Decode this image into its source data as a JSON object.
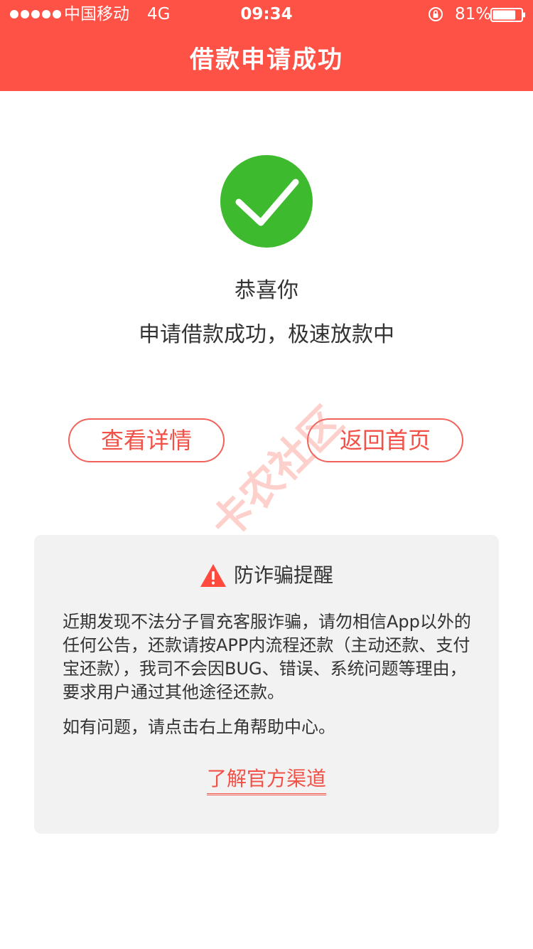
{
  "status_bar": {
    "carrier": "中国移动",
    "network": "4G",
    "time": "09:34",
    "battery_percent": "81%",
    "battery_level": 0.81
  },
  "header": {
    "title": "借款申请成功"
  },
  "result": {
    "congrats": "恭喜你",
    "message": "申请借款成功，极速放款中"
  },
  "actions": {
    "detail_label": "查看详情",
    "home_label": "返回首页"
  },
  "watermark": {
    "text": "卡农社区"
  },
  "notice": {
    "title": "防诈骗提醒",
    "body": "近期发现不法分子冒充客服诈骗，请勿相信App以外的任何公告，还款请按APP内流程还款（主动还款、支付宝还款），我司不会因BUG、错误、系统问题等理由，要求用户通过其他途径还款。",
    "help": "如有问题，请点击右上角帮助中心。",
    "link_label": "了解官方渠道"
  },
  "colors": {
    "brand_red": "#ff5246",
    "success_green": "#3dba2e",
    "accent_red": "#f25147",
    "card_bg": "#f2f2f2"
  },
  "icons": {
    "check": "checkmark-circle-icon",
    "warning": "warning-triangle-icon",
    "lock": "rotation-lock-icon",
    "battery": "battery-icon"
  }
}
